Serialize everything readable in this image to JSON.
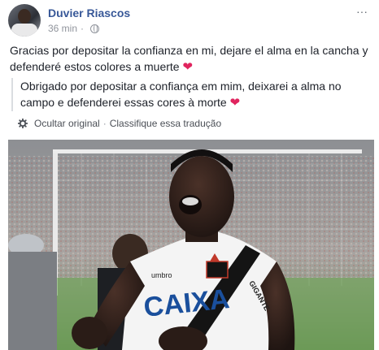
{
  "post": {
    "author": "Duvier Riascos",
    "time": "36 min",
    "more_label": "···",
    "original_text": "Gracias por depositar la confianza en mi, dejare el alma en la cancha y defenderé estos colores a muerte",
    "translated_text": "Obrigado por depositar a confiança em mim, deixarei a alma no campo e defenderei essas cores à morte",
    "heart": "❤",
    "hide_original_label": "Ocultar original",
    "separator": "·",
    "rate_translation_label": "Classifique essa tradução"
  },
  "photo": {
    "shirt_sponsor": "CAIXA",
    "kit_brand": "umbro",
    "sleeve_text": "GIGANTE"
  },
  "colors": {
    "author_link": "#385898",
    "meta_gray": "#90949c",
    "heart_red": "#e0245e",
    "pitch_green": "#6aa84f"
  },
  "icons": {
    "avatar": "profile-photo",
    "privacy": "globe-icon",
    "translate_settings": "gear-icon",
    "menu": "more-options-icon"
  }
}
